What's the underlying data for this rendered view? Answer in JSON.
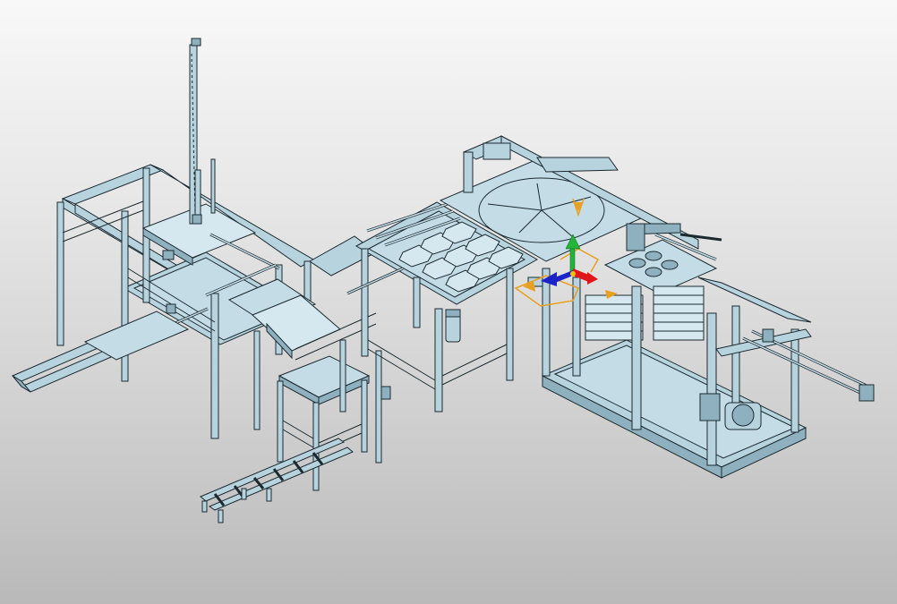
{
  "viewport": {
    "background_top": "#f8f8f8",
    "background_bottom": "#b9b9b9",
    "model_color": "#b7d3de",
    "edge_color": "#1c2a30"
  },
  "gizmo": {
    "x_axis_color": "#e0161b",
    "y_axis_color": "#21b53a",
    "z_axis_color": "#1a24c8",
    "ring_color": "#e8a020"
  }
}
